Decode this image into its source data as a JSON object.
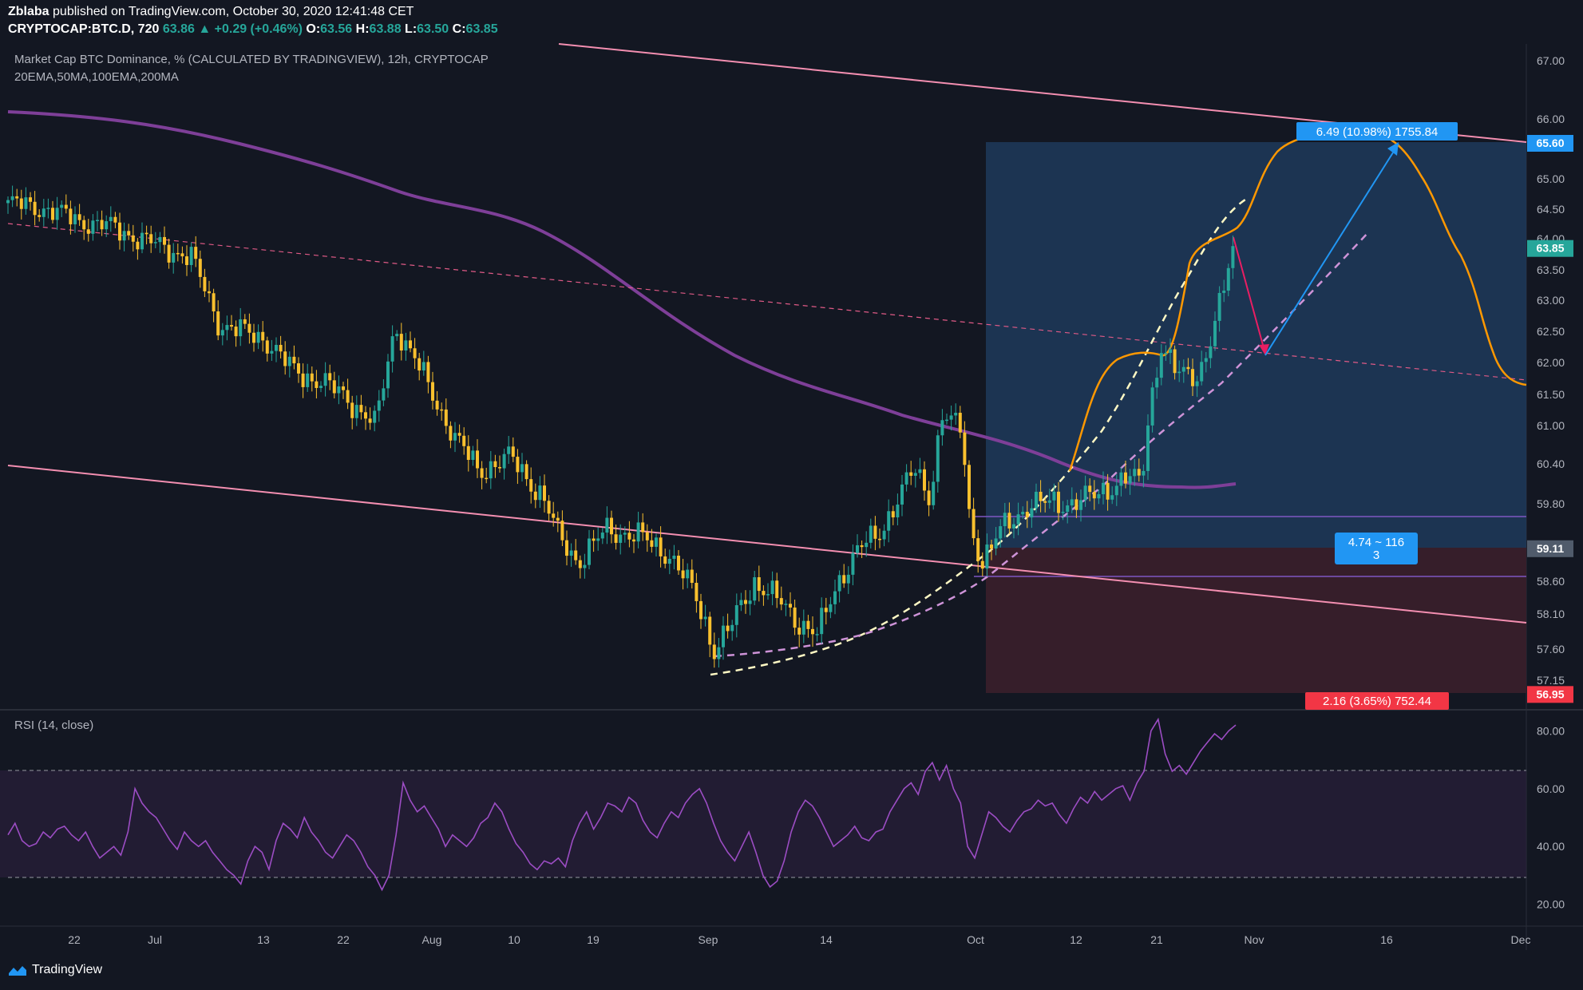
{
  "header": {
    "author": "Zblaba",
    "published": "published on TradingView.com, October 30, 2020 12:41:48 CET",
    "symbol": "CRYPTOCAP:BTC.D, 720",
    "last": "63.86",
    "change": "+0.29 (+0.46%)",
    "o_label": "O:",
    "o": "63.56",
    "h_label": "H:",
    "h": "63.88",
    "l_label": "L:",
    "l": "63.50",
    "c_label": "C:",
    "c": "63.85"
  },
  "legend": {
    "title": "Market Cap BTC Dominance, % (CALCULATED BY TRADINGVIEW), 12h, CRYPTOCAP",
    "indicators": "20EMA,50MA,100EMA,200MA"
  },
  "rsi": {
    "title": "RSI (14, close)"
  },
  "footer": {
    "brand": "TradingView"
  },
  "colors": {
    "background": "#131722",
    "up_candle": "#26a69a",
    "down_candle": "#f9c02e",
    "ma200": "#7e3f98",
    "channel": "#f48fb1",
    "projection": "#ff9800",
    "long_profit": "#1e3a5a",
    "long_loss": "#3b1f2b",
    "rsi_line": "#9c4dc4"
  },
  "chart_data": {
    "type": "candlestick",
    "price_axis": {
      "ticks": [
        "67.00",
        "66.00",
        "65.00",
        "64.50",
        "64.00",
        "63.50",
        "63.00",
        "62.50",
        "62.00",
        "61.50",
        "61.00",
        "60.40",
        "59.80",
        "58.60",
        "58.10",
        "57.60",
        "57.15"
      ],
      "ylim": [
        56.8,
        67.3
      ]
    },
    "price_labels": [
      {
        "value": 65.6,
        "text": "65.60",
        "color": "#2196f3"
      },
      {
        "value": 63.85,
        "text": "63.85",
        "color": "#26a69a"
      },
      {
        "value": 59.11,
        "text": "59.11",
        "color": "#505b6b"
      },
      {
        "value": 56.95,
        "text": "56.95",
        "color": "#f23645"
      }
    ],
    "x_labels": [
      "22",
      "Jul",
      "13",
      "22",
      "Aug",
      "10",
      "19",
      "Sep",
      "14",
      "Oct",
      "12",
      "21",
      "Nov",
      "16",
      "Dec"
    ],
    "position_tool": {
      "entry": 59.11,
      "target": 65.6,
      "stop": 56.95,
      "target_label": "6.49 (10.98%) 1755.84",
      "stop_label": "2.16 (3.65%) 752.44",
      "center_label_1": "4.74 ~ 116",
      "center_label_2": "3"
    },
    "rsi": {
      "ticks": [
        "80.00",
        "60.00",
        "40.00",
        "20.00"
      ],
      "ylim": [
        13,
        87
      ],
      "upper_band": 70,
      "lower_band": 30,
      "values": [
        44,
        48,
        42,
        40,
        41,
        45,
        43,
        46,
        47,
        44,
        42,
        45,
        40,
        36,
        38,
        40,
        37,
        45,
        60,
        55,
        52,
        50,
        46,
        42,
        39,
        45,
        42,
        40,
        42,
        38,
        35,
        32,
        30,
        27,
        35,
        40,
        38,
        32,
        42,
        48,
        46,
        43,
        50,
        45,
        42,
        38,
        36,
        40,
        44,
        42,
        38,
        33,
        30,
        25,
        30,
        44,
        62,
        56,
        52,
        54,
        50,
        46,
        40,
        44,
        42,
        40,
        43,
        48,
        50,
        55,
        52,
        46,
        41,
        38,
        34,
        32,
        35,
        34,
        36,
        33,
        42,
        48,
        52,
        46,
        50,
        55,
        54,
        52,
        57,
        55,
        49,
        45,
        43,
        48,
        52,
        50,
        55,
        58,
        60,
        55,
        48,
        42,
        38,
        35,
        40,
        45,
        38,
        30,
        26,
        28,
        35,
        45,
        52,
        56,
        54,
        50,
        45,
        40,
        42,
        44,
        47,
        43,
        42,
        45,
        46,
        52,
        56,
        60,
        62,
        58,
        66,
        69,
        63,
        68,
        60,
        55,
        40,
        36,
        44,
        52,
        50,
        47,
        45,
        49,
        52,
        53,
        56,
        54,
        55,
        51,
        48,
        53,
        57,
        55,
        59,
        56,
        58,
        60,
        61,
        56,
        62,
        66,
        80,
        84,
        72,
        66,
        68,
        65,
        69,
        73,
        76,
        79,
        77,
        80,
        82
      ]
    }
  }
}
